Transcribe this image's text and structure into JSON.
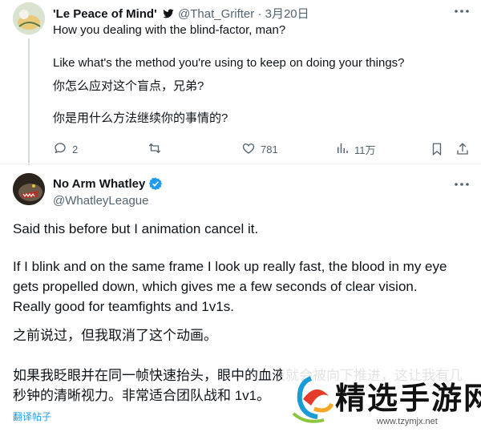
{
  "reply": {
    "display_name": "'Le Peace of Mind'",
    "handle": "@That_Grifter",
    "separator": "·",
    "date": "3月20日",
    "lines": [
      "How you dealing with the blind-factor, man?",
      "Like what's the method you're using to keep on doing your things?",
      "你怎么应对这个盲点，兄弟?",
      "你是用什么方法继续你的事情的?"
    ],
    "actions": {
      "replies": "2",
      "reposts": "",
      "likes": "781",
      "views": "11万"
    }
  },
  "main": {
    "display_name": "No Arm Whatley",
    "handle": "@WhatleyLeague",
    "paragraphs": [
      "Said this before but I animation cancel it.",
      "If I blink and on the same frame I look up really fast, the blood in my eye",
      "gets propelled down, which gives me a few seconds of clear vision.",
      "Really good for teamfights and 1v1s.",
      "之前说过，但我取消了这个动画。",
      "如果我眨眼并在同一帧快速抬头，眼中的血液就会被向下推进，这让我有几",
      "秒钟的清晰视力。非常适合团队战和 1v1。"
    ],
    "translate_label": "翻译帖子"
  },
  "watermark": {
    "title": "精选手游网",
    "url": "www.tzymjx.net"
  },
  "colors": {
    "text": "#0f1419",
    "muted": "#536471",
    "accent": "#1d9bf0",
    "divider": "#eff3f4"
  },
  "icons": [
    "verified-badge-icon",
    "more-icon",
    "reply-icon",
    "repost-icon",
    "like-icon",
    "views-icon",
    "bookmark-icon",
    "share-icon"
  ]
}
